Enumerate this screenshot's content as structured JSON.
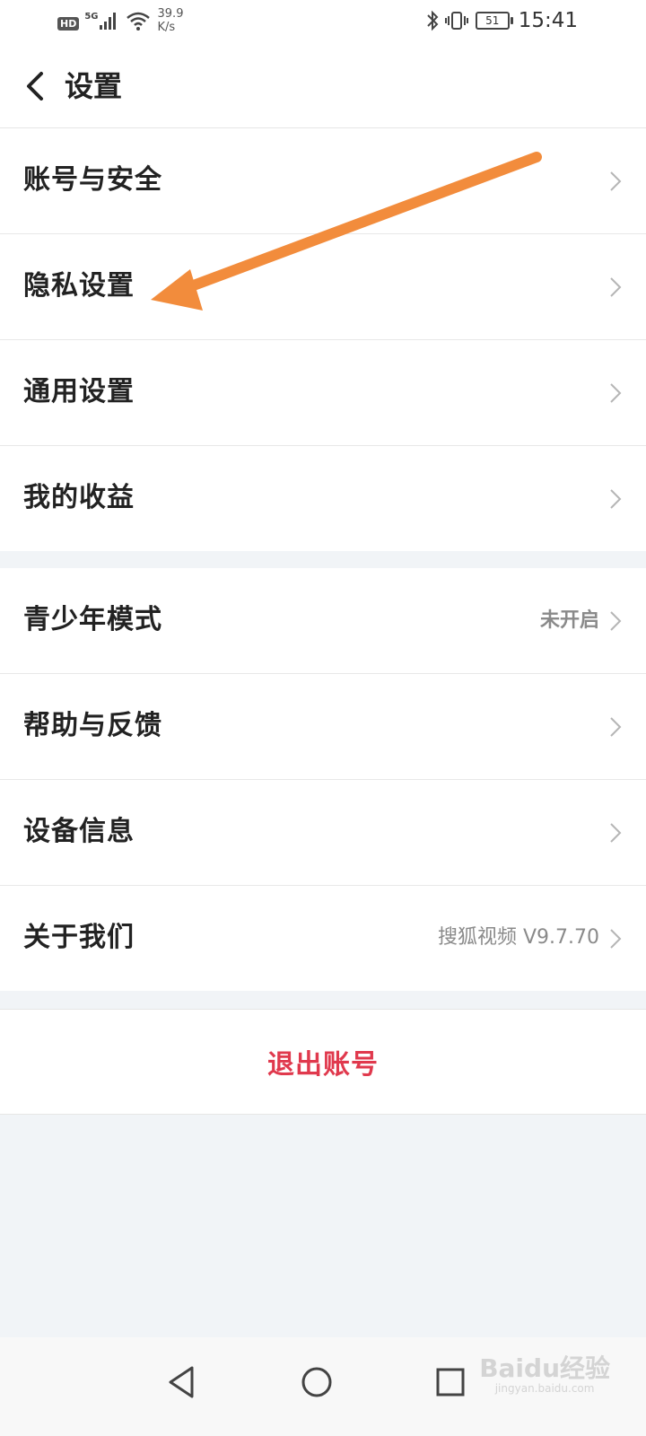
{
  "status_bar": {
    "hd_badge": "HD",
    "network_label": "5G",
    "speed_value": "39.9",
    "speed_unit": "K/s",
    "battery": "51",
    "time": "15:41"
  },
  "header": {
    "title": "设置",
    "back_icon": "chevron-left-icon"
  },
  "settings_group_1": [
    {
      "label": "账号与安全",
      "value": ""
    },
    {
      "label": "隐私设置",
      "value": ""
    },
    {
      "label": "通用设置",
      "value": ""
    },
    {
      "label": "我的收益",
      "value": ""
    }
  ],
  "settings_group_2": [
    {
      "label": "青少年模式",
      "value": "未开启"
    },
    {
      "label": "帮助与反馈",
      "value": ""
    },
    {
      "label": "设备信息",
      "value": ""
    },
    {
      "label": "关于我们",
      "value": "搜狐视频 V9.7.70"
    }
  ],
  "logout": {
    "label": "退出账号"
  },
  "annotation": {
    "arrow_color": "#f28c3c"
  },
  "nav_bar": {
    "back": "triangle-back-icon",
    "home": "circle-home-icon",
    "recents": "square-recents-icon"
  },
  "watermark": {
    "brand": "Baidu经验",
    "domain": "jingyan.baidu.com"
  },
  "colors": {
    "accent_red": "#e0394d",
    "background": "#f1f4f7"
  }
}
